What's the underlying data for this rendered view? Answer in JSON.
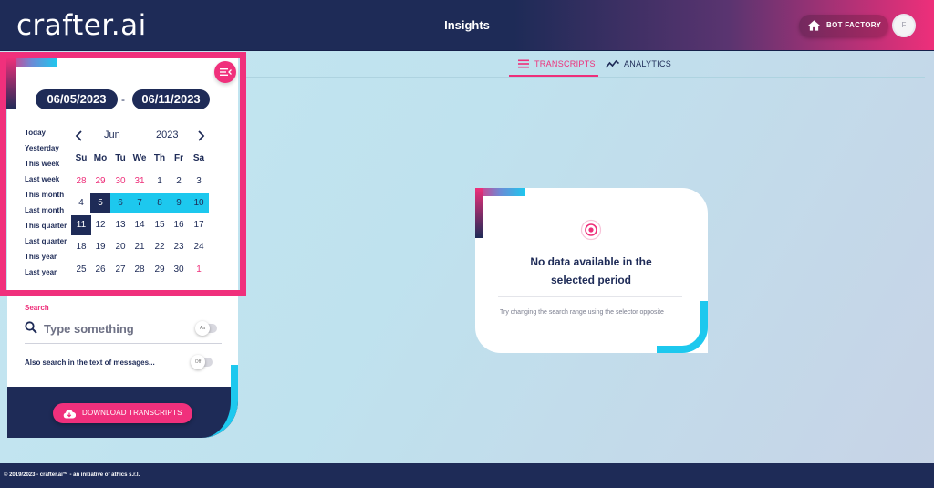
{
  "header": {
    "logo": "crafter.ai",
    "title": "Insights",
    "bot_factory_label": "BOT FACTORY",
    "avatar_initial": "F"
  },
  "date_range": {
    "start": "06/05/2023",
    "separator": "-",
    "end": "06/11/2023"
  },
  "presets": [
    "Today",
    "Yesterday",
    "This week",
    "Last week",
    "This month",
    "Last month",
    "This quarter",
    "Last quarter",
    "This year",
    "Last year"
  ],
  "calendar": {
    "month": "Jun",
    "year": "2023",
    "weekdays": [
      "Su",
      "Mo",
      "Tu",
      "We",
      "Th",
      "Fr",
      "Sa"
    ],
    "weeks": [
      [
        "28",
        "29",
        "30",
        "31",
        "1",
        "2",
        "3"
      ],
      [
        "4",
        "5",
        "6",
        "7",
        "8",
        "9",
        "10"
      ],
      [
        "11",
        "12",
        "13",
        "14",
        "15",
        "16",
        "17"
      ],
      [
        "18",
        "19",
        "20",
        "21",
        "22",
        "23",
        "24"
      ],
      [
        "25",
        "26",
        "27",
        "28",
        "29",
        "30",
        "1"
      ]
    ],
    "range_start": "5",
    "range_end": "11"
  },
  "search": {
    "label": "Search",
    "placeholder": "Type something",
    "case_toggle_label": "Aa",
    "also_search_label": "Also search in the text of messages...",
    "also_search_toggle": "Off"
  },
  "download_label": "DOWNLOAD TRANSCRIPTS",
  "tabs": [
    {
      "label": "TRANSCRIPTS",
      "active": true
    },
    {
      "label": "ANALYTICS",
      "active": false
    }
  ],
  "empty_state": {
    "title_line1": "No data available in the",
    "title_line2": "selected period",
    "message": "Try changing the search range using the selector opposite"
  },
  "footer": "© 2019/2023 - crafter.ai™ - an initiative of athics s.r.l.",
  "colors": {
    "navy": "#1e2b57",
    "pink": "#f0307c",
    "cyan": "#1dc8ee"
  }
}
